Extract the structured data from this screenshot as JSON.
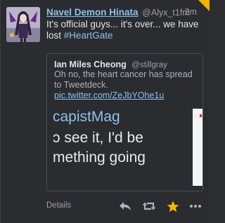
{
  "tweet": {
    "display_name": "Navel Demon Hinata",
    "handle": "@Alyx_t1fm",
    "timestamp": "2m",
    "text_before": "It's official guys... it's over... we have lost ",
    "hashtag": "#HeartGate",
    "favorited": true
  },
  "quote": {
    "name": "Ian Miles Cheong",
    "handle": "@stillgray",
    "text": "Oh no, the heart cancer has spread to Tweetdeck.",
    "link": "pic.twitter.com/ZeJbYOhe1u",
    "media_lines": [
      "capistMag",
      "ɔ see it, I'd be",
      "mething going"
    ]
  },
  "footer": {
    "details_label": "Details",
    "reply_icon": "reply-icon",
    "retweet_icon": "retweet-icon",
    "favorite_icon": "star-icon",
    "more_icon": "more-icon"
  },
  "colors": {
    "background": "#2a2c30",
    "link_blue": "#8fc0ea",
    "favorite_gold": "#f5b400",
    "icon_gray": "#9aa0a8"
  }
}
